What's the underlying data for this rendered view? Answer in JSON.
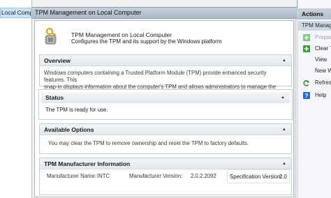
{
  "tree": {
    "selected_item": "Local Comp"
  },
  "window": {
    "title": "TPM Management on Local Computer"
  },
  "header": {
    "title": "TPM Management on Local Computer",
    "description": "Configures the TPM and its support by the Windows platform"
  },
  "sections": {
    "overview": {
      "title": "Overview",
      "line1": "Windows computers containing a Trusted Platform Module (TPM) provide enhanced security features. This",
      "line2": "snap-in displays information about the computer's TPM and allows administrators to manage the device."
    },
    "status": {
      "title": "Status",
      "text": "The TPM is ready for use."
    },
    "options": {
      "title": "Available Options",
      "text": "You may clear the TPM to remove ownership and reset the TPM to factory defaults."
    },
    "manufacturer": {
      "title": "TPM Manufacturer Information",
      "name_label": "Manufacturer Name:",
      "name_value": "INTC",
      "version_label": "Manufacturer Version:",
      "version_value": "2.0.2.2092",
      "spec_label": "Specification Version:",
      "spec_value": "2.0"
    }
  },
  "actions": {
    "title": "Actions",
    "subheader": "TPM Management",
    "items": [
      {
        "label": "Prepare",
        "icon": "prepare-tpm-icon",
        "enabled": false
      },
      {
        "label": "Clear T",
        "icon": "clear-tpm-icon",
        "enabled": true
      },
      {
        "label": "View",
        "icon": "",
        "enabled": true
      },
      {
        "label": "New W",
        "icon": "",
        "enabled": true
      },
      {
        "label": "Refresh",
        "icon": "refresh-icon",
        "enabled": true
      },
      {
        "label": "Help",
        "icon": "help-icon",
        "enabled": true
      }
    ]
  },
  "colors": {
    "accent": "#cce4f7",
    "panel_header": "#aebac8",
    "green_icon": "#3e9a3e",
    "help_icon": "#2b6cc4"
  }
}
